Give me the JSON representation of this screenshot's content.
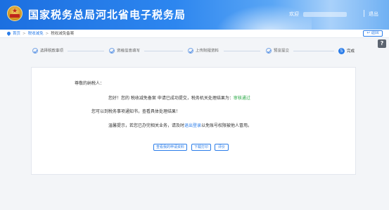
{
  "header": {
    "title": "国家税务总局河北省电子税务局",
    "welcome": "欢迎",
    "logout": "退出"
  },
  "breadcrumb": {
    "home": "首页",
    "level1": "税收减免",
    "current": "税收减免备案"
  },
  "back_button": "返回",
  "help_icon_glyph": "?",
  "steps": [
    {
      "label": "选择税款事项",
      "state": "done"
    },
    {
      "label": "资格信息填写",
      "state": "done"
    },
    {
      "label": "上传附报资料",
      "state": "done"
    },
    {
      "label": "预览提交",
      "state": "done"
    },
    {
      "label": "完成",
      "state": "active",
      "number": "5"
    }
  ],
  "result": {
    "greeting": "尊敬的纳税人：",
    "message_prefix": "您好！您的 税收减免备案 申请已成功提交，税务机关处理结果为：",
    "status": "审核通过",
    "notice": "您可以到税务事项通知书，查看具体处理结果！",
    "tip_prefix": "温馨提示，若您已办完相关业务，请及时",
    "tip_link": "退出登录",
    "tip_suffix": "以免账号权限被他人冒用。"
  },
  "buttons": {
    "view": "查看我的申请资料",
    "download": "下载打印",
    "rate": "评价"
  },
  "colors": {
    "primary": "#2b7de9",
    "success": "#27a844",
    "header_start": "#1c6fe0"
  }
}
